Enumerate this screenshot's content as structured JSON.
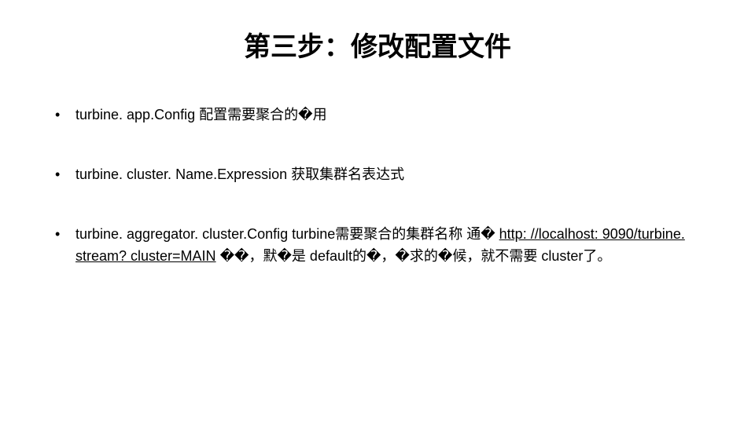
{
  "title": "第三步：修改配置文件",
  "bullets": {
    "b1_code": "turbine. app.Config",
    "b1_text": " 配置需要聚合的�用",
    "b2_code": "turbine. cluster. Name.Expression",
    "b2_text": " 获取集群名表达式",
    "b3_code": "turbine. aggregator. cluster.Config",
    "b3_mid": "   turbine需要聚合的集群名称 通� ",
    "b3_link": "http: //localhost: 9090/turbine. stream? cluster=MAIN",
    "b3_tail": " ��，默�是 default的�，�求的�候，就不需要 cluster了。"
  }
}
